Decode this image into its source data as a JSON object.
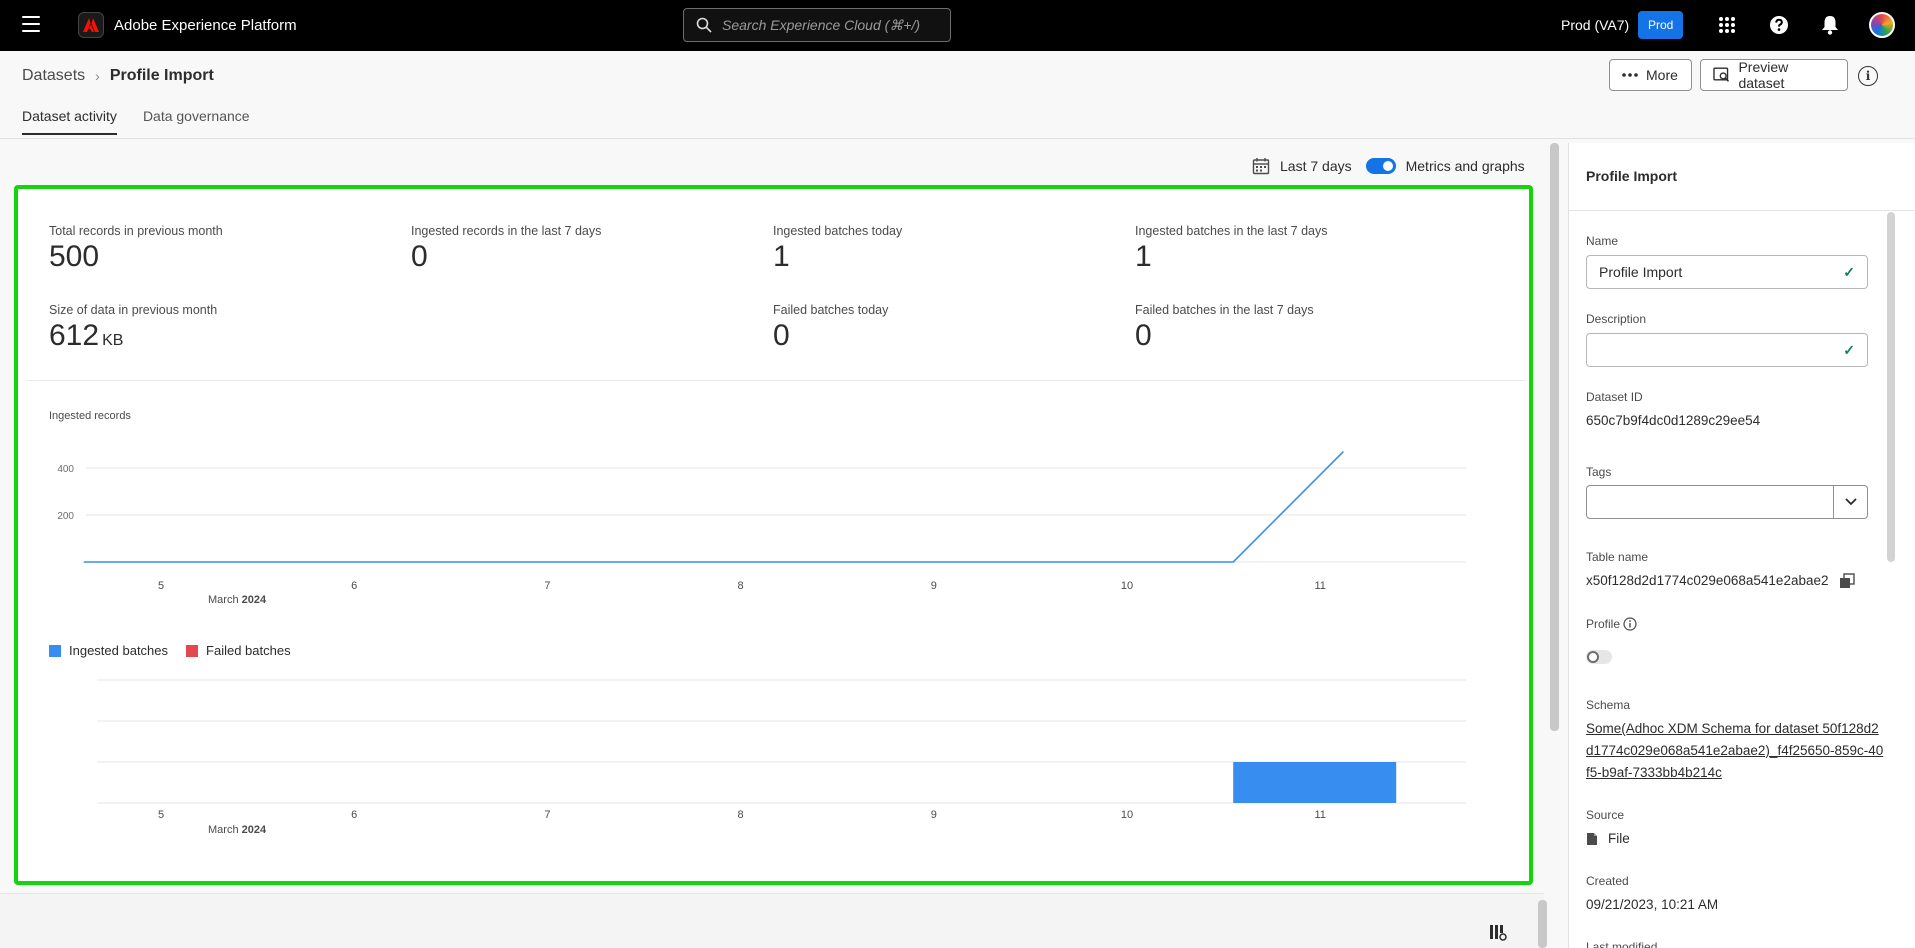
{
  "topbar": {
    "app_name": "Adobe Experience Platform",
    "search_placeholder": "Search Experience Cloud (⌘+/)",
    "org": "Prod (VA7)",
    "env_badge": "Prod"
  },
  "header": {
    "breadcrumb_parent": "Datasets",
    "breadcrumb_current": "Profile Import",
    "more_label": "More",
    "preview_label": "Preview dataset",
    "info_glyph": "i"
  },
  "tabs": [
    {
      "label": "Dataset activity",
      "active": true
    },
    {
      "label": "Data governance",
      "active": false
    }
  ],
  "controls": {
    "range_label": "Last 7 days",
    "toggle_label": "Metrics and graphs"
  },
  "stats": {
    "total_records_label": "Total records in previous month",
    "total_records_value": "500",
    "ingested_records_7d_label": "Ingested records in the last 7 days",
    "ingested_records_7d_value": "0",
    "ingested_batches_today_label": "Ingested batches today",
    "ingested_batches_today_value": "1",
    "ingested_batches_7d_label": "Ingested batches in the last 7 days",
    "ingested_batches_7d_value": "1",
    "size_label": "Size of data in previous month",
    "size_value": "612",
    "size_unit": "KB",
    "failed_today_label": "Failed batches today",
    "failed_today_value": "0",
    "failed_7d_label": "Failed batches in the last 7 days",
    "failed_7d_value": "0"
  },
  "chart_data": [
    {
      "type": "line",
      "title": "Ingested records",
      "categories": [
        "5",
        "6",
        "7",
        "8",
        "9",
        "10",
        "11"
      ],
      "x_caption_month": "March",
      "x_caption_year": "2024",
      "yticks": [
        "200",
        "400"
      ],
      "ylim": [
        0,
        400
      ],
      "grid": true,
      "color": "#378ef0",
      "points": [
        {
          "x": 4.6,
          "y": 0
        },
        {
          "x": 5,
          "y": 0
        },
        {
          "x": 6,
          "y": 0
        },
        {
          "x": 7,
          "y": 0
        },
        {
          "x": 8,
          "y": 0
        },
        {
          "x": 9,
          "y": 0
        },
        {
          "x": 10,
          "y": 0
        },
        {
          "x": 10.55,
          "y": 0
        },
        {
          "x": 11.12,
          "y": 470
        }
      ]
    },
    {
      "type": "bar",
      "categories": [
        "5",
        "6",
        "7",
        "8",
        "9",
        "10",
        "11"
      ],
      "x_caption_month": "March",
      "x_caption_year": "2024",
      "grid": true,
      "legend": "top-left",
      "series": [
        {
          "name": "Ingested batches",
          "color": "#378ef0",
          "values": [
            0,
            0,
            0,
            0,
            0,
            0,
            1
          ]
        },
        {
          "name": "Failed batches",
          "color": "#e34850",
          "values": [
            0,
            0,
            0,
            0,
            0,
            0,
            0
          ]
        }
      ]
    }
  ],
  "panel": {
    "title": "Profile Import",
    "name_label": "Name",
    "name_value": "Profile Import",
    "description_label": "Description",
    "description_value": "",
    "dataset_id_label": "Dataset ID",
    "dataset_id_value": "650c7b9f4dc0d1289c29ee54",
    "tags_label": "Tags",
    "table_name_label": "Table name",
    "table_name_value": "x50f128d2d1774c029e068a541e2abae2",
    "profile_label": "Profile",
    "schema_label": "Schema",
    "schema_value": "Some(Adhoc XDM Schema for dataset 50f128d2d1774c029e068a541e2abae2)_f4f25650-859c-40f5-b9af-7333bb4b214c",
    "source_label": "Source",
    "source_value": "File",
    "created_label": "Created",
    "created_value": "09/21/2023, 10:21 AM",
    "last_modified_label": "Last modified"
  }
}
